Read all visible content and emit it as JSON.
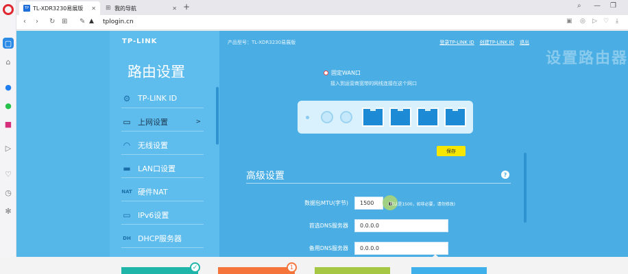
{
  "browser": {
    "tabs": [
      {
        "label": "TL-XDR3230易展版",
        "favicon": "TP"
      },
      {
        "label": "我的导航"
      }
    ],
    "url": "tplogin.cn"
  },
  "router": {
    "logo": "TP-LINK",
    "sidebar_title": "路由设置",
    "model": "产品型号：TL-XDR3230易展版",
    "links": [
      "登录TP-LINK ID",
      "创建TP-LINK ID",
      "退出"
    ],
    "watermark": "设置路由器",
    "menu": [
      {
        "label": "TP-LINK ID",
        "icon": "gear-icon",
        "glyph": "⚙"
      },
      {
        "label": "上网设置",
        "icon": "monitor-icon",
        "glyph": "▭",
        "chevron": ">"
      },
      {
        "label": "无线设置",
        "icon": "wifi-icon",
        "glyph": "◠"
      },
      {
        "label": "LAN口设置",
        "icon": "router-icon",
        "glyph": "▬"
      },
      {
        "label": "硬件NAT",
        "icon": "nat-icon",
        "glyph": "NAT"
      },
      {
        "label": "IPv6设置",
        "icon": "monitor-icon",
        "glyph": "▭"
      },
      {
        "label": "DHCP服务器",
        "icon": "dhcp-icon",
        "glyph": "DH"
      }
    ],
    "wan": {
      "label": "固定WAN口",
      "desc": "接入到运营商宽带的网线连接在这个网口"
    },
    "save_label": "保存",
    "advanced": {
      "title": "高级设置",
      "help": "?",
      "mtu_label": "数据包MTU(字节)",
      "mtu_value": "1500",
      "mtu_hint": "(默认是1500，如非必要，请勿修改)",
      "dns1_label": "首选DNS服务器",
      "dns1_value": "0.0.0.0",
      "dns2_label": "备用DNS服务器",
      "dns2_value": "0.0.0.0"
    }
  },
  "bottom": {
    "badge1": "✓",
    "badge2": "1"
  },
  "colors": {
    "page_bg": "#55b7e8",
    "sidebar_bg": "#5fbdee",
    "content_bg": "#4aaee4",
    "save_yellow": "#f6e600",
    "port_blue": "#1d8ad6"
  }
}
